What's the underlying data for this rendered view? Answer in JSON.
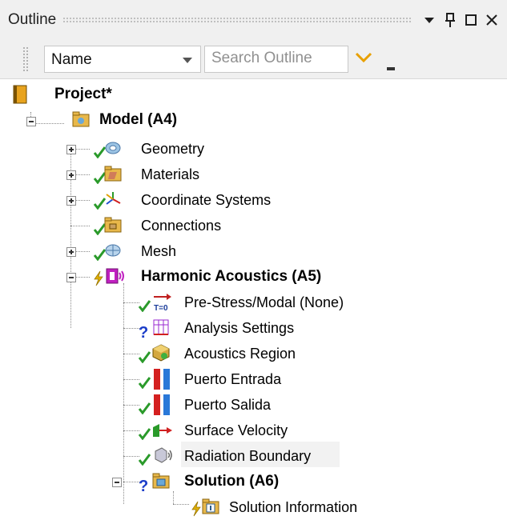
{
  "panel": {
    "title": "Outline",
    "buttons": [
      "dropdown-icon",
      "pin-icon",
      "maximize-icon",
      "close-icon"
    ]
  },
  "toolbar": {
    "name_combo": "Name",
    "search_placeholder": "Search Outline"
  },
  "tree": {
    "project": "Project*",
    "model": "Model (A4)",
    "geometry": "Geometry",
    "materials": "Materials",
    "coordinate_systems": "Coordinate Systems",
    "connections": "Connections",
    "mesh": "Mesh",
    "harmonic": "Harmonic Acoustics (A5)",
    "prestress": "Pre-Stress/Modal (None)",
    "analysis_settings": "Analysis Settings",
    "acoustics_region": "Acoustics Region",
    "puerto_entrada": "Puerto Entrada",
    "puerto_salida": "Puerto Salida",
    "surface_velocity": "Surface Velocity",
    "radiation_boundary": "Radiation Boundary",
    "solution": "Solution (A6)",
    "solution_information": "Solution Information",
    "prestress_badge": "T=0"
  },
  "colors": {
    "check": "#2a9a2a",
    "question": "#1a3cc8",
    "lightning": "#e0b000",
    "folder": "#e8b84a"
  }
}
